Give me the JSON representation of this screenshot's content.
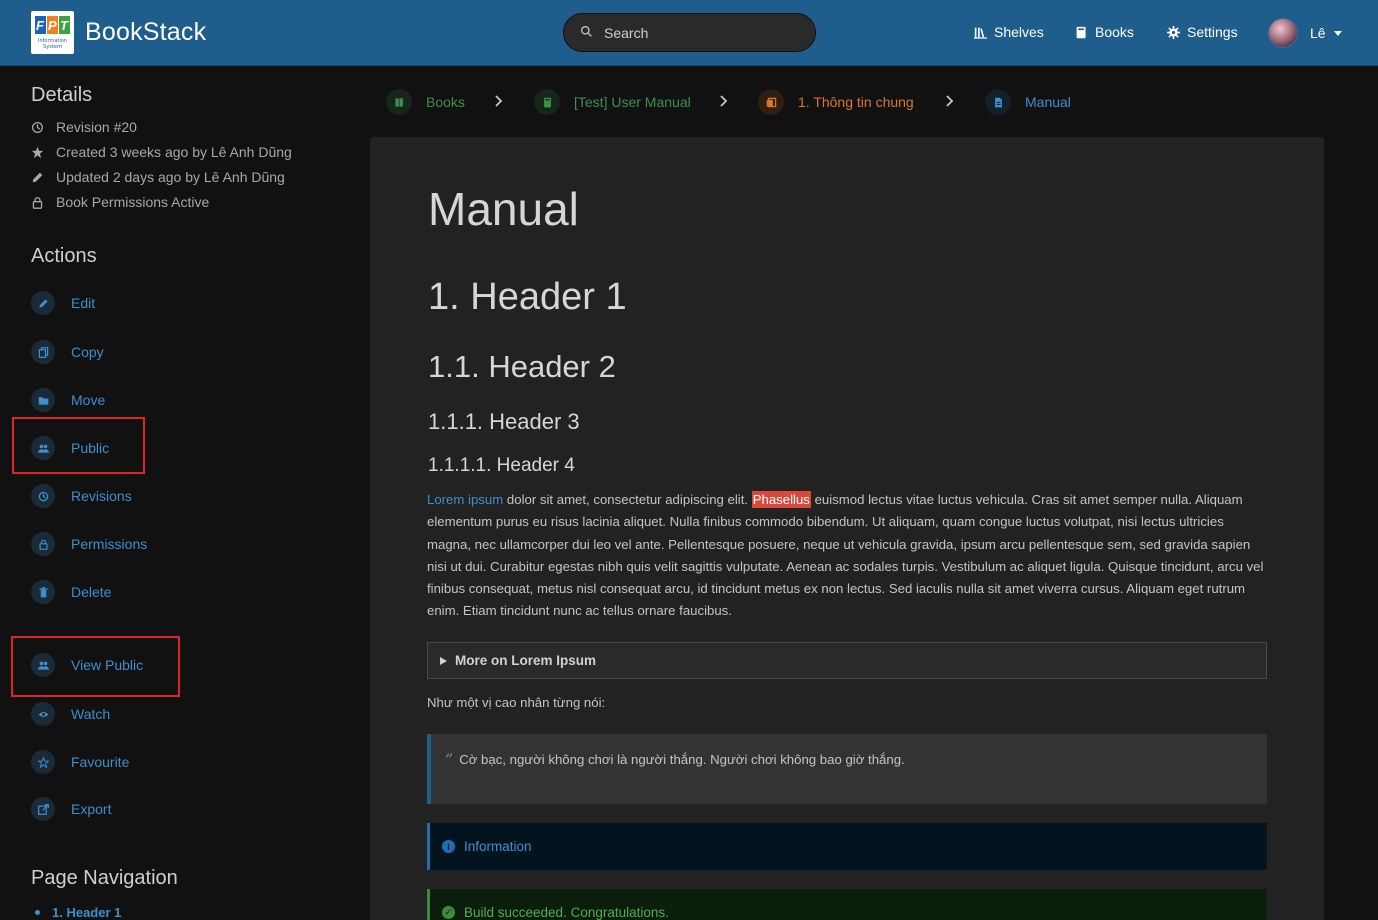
{
  "header": {
    "app_name": "BookStack",
    "logo_text": "Information System",
    "search_placeholder": "Search",
    "nav": {
      "shelves": "Shelves",
      "books": "Books",
      "settings": "Settings"
    },
    "user": "Lê",
    "brand_color": "#1f5e8c"
  },
  "sidebar": {
    "details_title": "Details",
    "details": [
      {
        "icon": "history-icon",
        "text": "Revision #20"
      },
      {
        "icon": "star-icon",
        "text": "Created 3 weeks ago by Lê Anh Dũng"
      },
      {
        "icon": "pencil-icon",
        "text": "Updated 2 days ago by Lê Anh Dũng"
      },
      {
        "icon": "lock-icon",
        "text": "Book Permissions Active"
      }
    ],
    "actions_title": "Actions",
    "actions": [
      {
        "icon": "edit-icon",
        "label": "Edit"
      },
      {
        "icon": "copy-icon",
        "label": "Copy"
      },
      {
        "icon": "folder-icon",
        "label": "Move"
      },
      {
        "icon": "users-icon",
        "label": "Public"
      },
      {
        "icon": "history-icon",
        "label": "Revisions"
      },
      {
        "icon": "lock-icon",
        "label": "Permissions"
      },
      {
        "icon": "trash-icon",
        "label": "Delete"
      },
      {
        "icon": "users-icon",
        "label": "View Public"
      },
      {
        "icon": "eye-icon",
        "label": "Watch"
      },
      {
        "icon": "star-icon",
        "label": "Favourite"
      },
      {
        "icon": "export-icon",
        "label": "Export"
      }
    ],
    "page_nav_title": "Page Navigation",
    "page_nav": [
      {
        "label": "1. Header 1"
      }
    ],
    "highlight_color": "#e0242a"
  },
  "breadcrumbs": [
    {
      "label": "Books",
      "color": "#3d8f4a"
    },
    {
      "label": "[Test] User Manual",
      "color": "#3d8f4a"
    },
    {
      "label": "1. Thông tin chung",
      "color": "#d9762a"
    },
    {
      "label": "Manual",
      "color": "#3d8fce"
    }
  ],
  "page": {
    "title": "Manual",
    "h1": "1. Header 1",
    "h2": "1.1. Header 2",
    "h3": "1.1.1. Header 3",
    "h4": "1.1.1.1. Header 4",
    "para_link": "Lorem ipsum",
    "para_part1": " dolor sit amet, consectetur adipiscing elit. ",
    "para_mark": "Phasellus",
    "para_part2": " euismod lectus vitae luctus vehicula. Cras sit amet semper nulla. Aliquam elementum purus eu risus lacinia aliquet. Nulla finibus commodo bibendum. Ut aliquam, quam congue luctus volutpat, nisi lectus ultricies magna, nec ullamcorper dui leo vel ante. Pellentesque posuere, neque ut vehicula gravida, ipsum arcu pellentesque sem, sed gravida sapien nisi ut dui. Curabitur egestas nibh quis velit sagittis vulputate. Aenean ac sodales turpis. Vestibulum ac aliquet ligula. Quisque tincidunt, arcu vel finibus consequat, metus nisl consequat arcu, id tincidunt metus ex non lectus. Sed iaculis nulla sit amet viverra cursus. Aliquam eget rutrum enim. Etiam tincidunt nunc ac tellus ornare faucibus.",
    "details_summary": "More on Lorem Ipsum",
    "saying": "Như một vị cao nhân từng nói:",
    "quote_mark": "”",
    "quote": "Cờ bạc, người không chơi là người thắng. Người chơi không bao giờ thắng.",
    "callout_info": "Information",
    "callout_success": "Build succeeded. Congratulations."
  }
}
